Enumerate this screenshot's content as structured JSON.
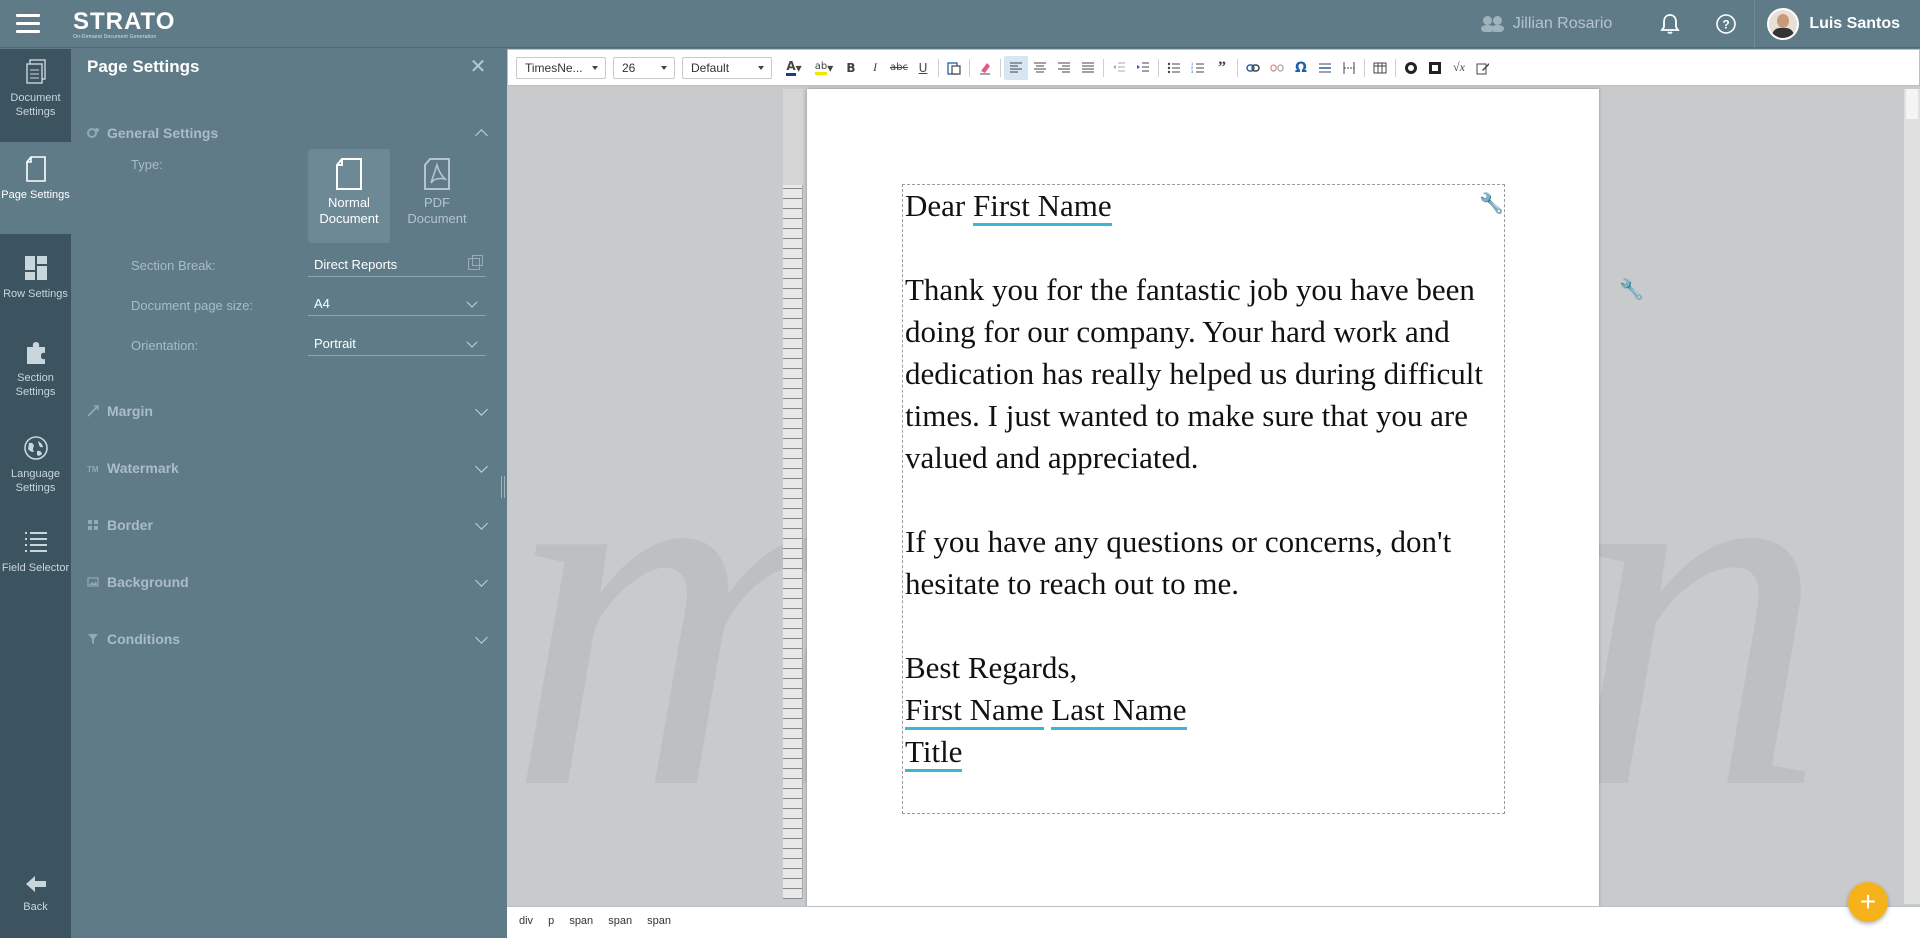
{
  "app": {
    "name": "STRATO",
    "tagline": "On-Demand Document Generation"
  },
  "topbar": {
    "collaborator": "Jillian Rosario",
    "user_name": "Luis Santos",
    "icons": [
      "menu-icon",
      "bell-icon",
      "help-icon",
      "people-icon"
    ]
  },
  "rail": {
    "items": [
      {
        "label": "Document Settings",
        "icon": "document-icon",
        "active": false
      },
      {
        "label": "Page Settings",
        "icon": "page-icon",
        "active": true
      },
      {
        "label": "Row Settings",
        "icon": "rows-icon",
        "active": false
      },
      {
        "label": "Section Settings",
        "icon": "puzzle-icon",
        "active": false
      },
      {
        "label": "Language Settings",
        "icon": "globe-icon",
        "active": false
      },
      {
        "label": "Field Selector",
        "icon": "list-icon",
        "active": false
      }
    ],
    "back_label": "Back"
  },
  "panel": {
    "title": "Page Settings",
    "general": {
      "title": "General Settings",
      "type_label": "Type:",
      "type_normal": "Normal Document",
      "type_pdf": "PDF Document",
      "section_break_label": "Section Break:",
      "section_break_value": "Direct Reports",
      "page_size_label": "Document page size:",
      "page_size_value": "A4",
      "orientation_label": "Orientation:",
      "orientation_value": "Portrait"
    },
    "sections": [
      "Margin",
      "Watermark",
      "Border",
      "Background",
      "Conditions"
    ]
  },
  "toolbar": {
    "font_family": "TimesNe...",
    "font_size": "26",
    "style": "Default"
  },
  "document": {
    "greeting_prefix": "Dear ",
    "greeting_field": "First Name",
    "para1": "Thank you for the fantastic job you have been doing for our company. Your hard work and dedication has really helped us during difficult times. I just wanted to make sure that you are valued and appreciated.",
    "para2": "If you have any questions or concerns, don't hesitate to reach out to me.",
    "closing": "Best Regards,",
    "sig_first": "First Name",
    "sig_last": "Last Name",
    "sig_title": "Title"
  },
  "statusbar": {
    "path": [
      "div",
      "p",
      "span",
      "span",
      "span"
    ]
  },
  "colors": {
    "header": "#5f7b88",
    "rail": "#3c5460",
    "field_underline": "#3ab6d6",
    "fab": "#f6b21a"
  }
}
